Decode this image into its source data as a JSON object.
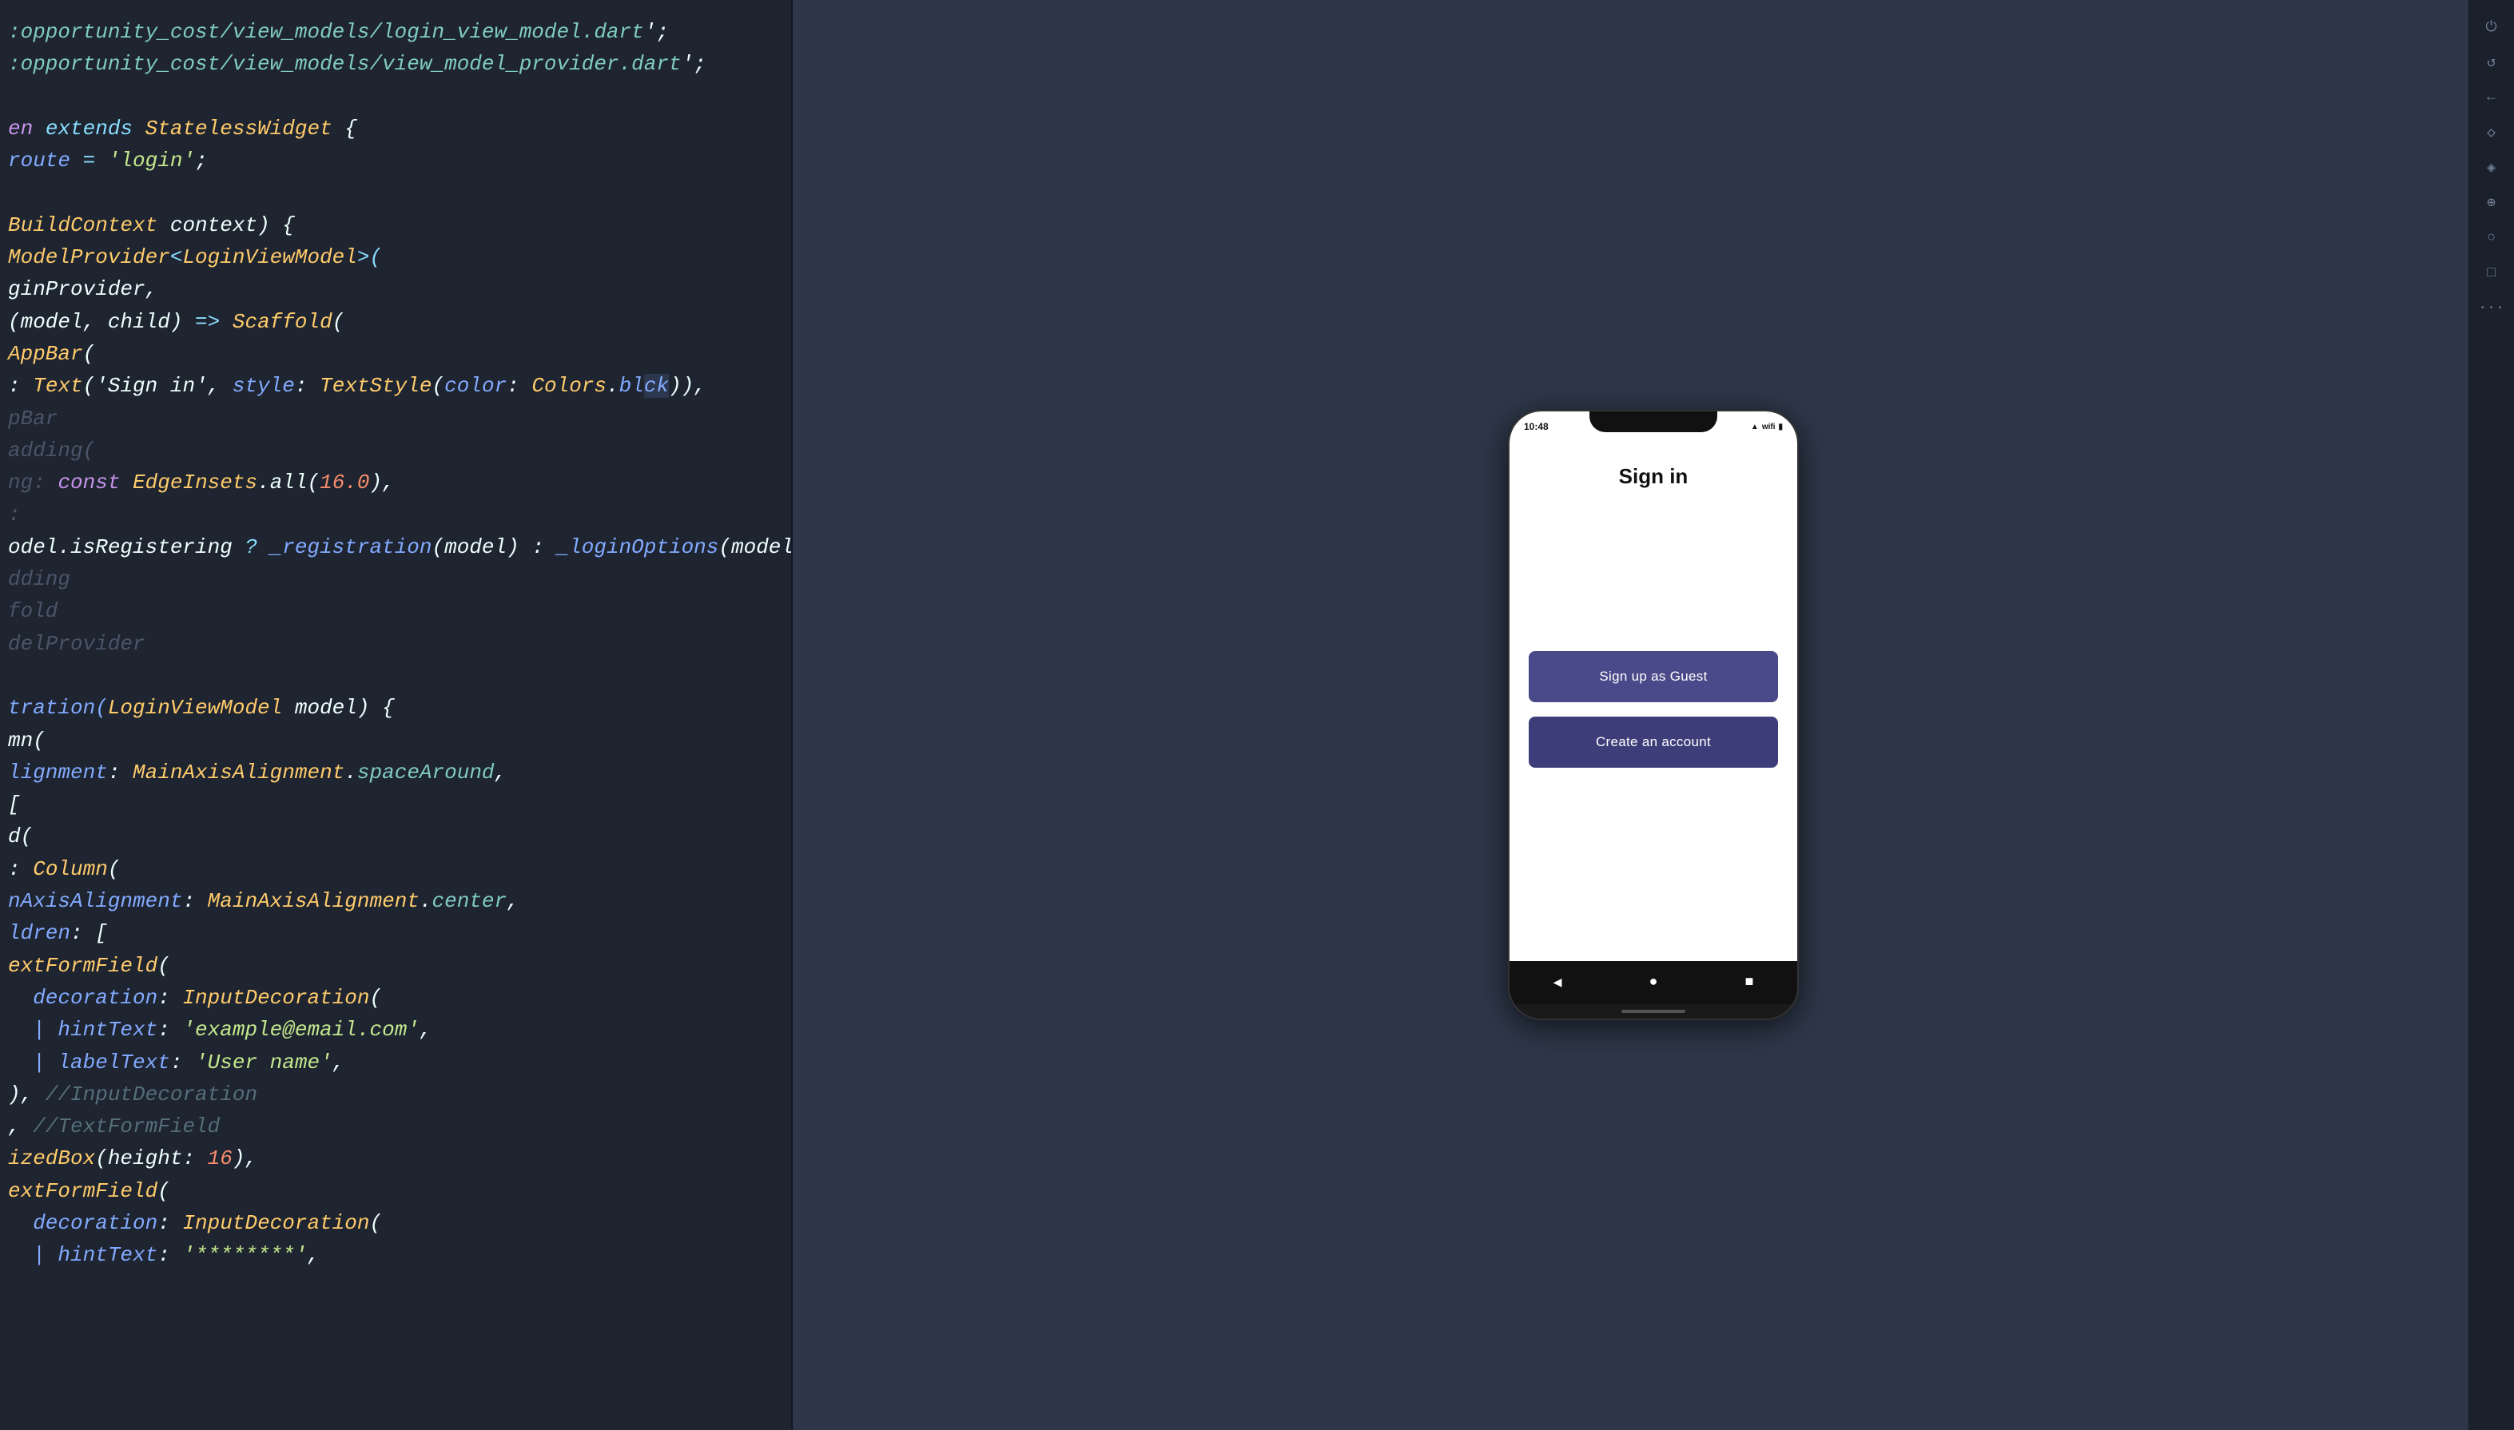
{
  "editor": {
    "lines": [
      {
        "id": 1,
        "segments": [
          {
            "text": ":opportunity_cost/view_models/login_view_model.dart",
            "class": "kw-teal"
          },
          {
            "text": "';",
            "class": "kw-white"
          }
        ]
      },
      {
        "id": 2,
        "segments": [
          {
            "text": ":opportunity_cost/view_models/view_model_provider.dart",
            "class": "kw-teal"
          },
          {
            "text": "';",
            "class": "kw-white"
          }
        ]
      },
      {
        "id": 3,
        "segments": []
      },
      {
        "id": 4,
        "segments": [
          {
            "text": "en ",
            "class": "kw-purple"
          },
          {
            "text": "extends ",
            "class": "kw-cyan"
          },
          {
            "text": "StatelessWidget ",
            "class": "kw-yellow"
          },
          {
            "text": "{",
            "class": "kw-white"
          }
        ]
      },
      {
        "id": 5,
        "segments": [
          {
            "text": "route ",
            "class": "kw-blue"
          },
          {
            "text": "= ",
            "class": "kw-cyan"
          },
          {
            "text": "'login'",
            "class": "kw-string"
          },
          {
            "text": ";",
            "class": "kw-white"
          }
        ]
      },
      {
        "id": 6,
        "segments": []
      },
      {
        "id": 7,
        "segments": [
          {
            "text": "BuildContext ",
            "class": "kw-yellow"
          },
          {
            "text": "context",
            "class": "kw-white"
          },
          {
            "text": ") {",
            "class": "kw-white"
          }
        ]
      },
      {
        "id": 8,
        "segments": [
          {
            "text": "ModelProvider",
            "class": "kw-yellow"
          },
          {
            "text": "<",
            "class": "kw-cyan"
          },
          {
            "text": "LoginViewModel",
            "class": "kw-yellow"
          },
          {
            "text": ">(",
            "class": "kw-cyan"
          }
        ]
      },
      {
        "id": 9,
        "segments": [
          {
            "text": "ginProvider,",
            "class": "kw-white"
          }
        ]
      },
      {
        "id": 10,
        "segments": [
          {
            "text": "(model, child) ",
            "class": "kw-white"
          },
          {
            "text": "=> ",
            "class": "kw-cyan"
          },
          {
            "text": "Scaffold",
            "class": "kw-yellow"
          },
          {
            "text": "(",
            "class": "kw-white"
          }
        ]
      },
      {
        "id": 11,
        "segments": [
          {
            "text": "AppBar",
            "class": "kw-yellow"
          },
          {
            "text": "(",
            "class": "kw-white"
          }
        ]
      },
      {
        "id": 12,
        "segments": [
          {
            "text": ": ",
            "class": "kw-white"
          },
          {
            "text": "Text",
            "class": "kw-yellow"
          },
          {
            "text": "('Sign in', ",
            "class": "kw-white"
          },
          {
            "text": "style",
            "class": "kw-blue"
          },
          {
            "text": ": ",
            "class": "kw-white"
          },
          {
            "text": "TextStyle",
            "class": "kw-yellow"
          },
          {
            "text": "(",
            "class": "kw-white"
          },
          {
            "text": "color",
            "class": "kw-blue"
          },
          {
            "text": ": ",
            "class": "kw-white"
          },
          {
            "text": "Colors",
            "class": "kw-yellow"
          },
          {
            "text": ".",
            "class": "kw-white"
          },
          {
            "text": "bl",
            "class": "kw-blue"
          },
          {
            "text": "ck",
            "class": "kw-blue highlight-bg"
          },
          {
            "text": ")),",
            "class": "kw-white"
          }
        ],
        "highlight": true
      },
      {
        "id": 13,
        "segments": [
          {
            "text": "pBar",
            "class": "kw-dim"
          }
        ]
      },
      {
        "id": 14,
        "segments": [
          {
            "text": "adding",
            "class": "kw-dim"
          },
          {
            "text": "(",
            "class": "kw-dim"
          }
        ]
      },
      {
        "id": 15,
        "segments": [
          {
            "text": "ng",
            "class": "kw-dim"
          },
          {
            "text": ": ",
            "class": "kw-dim"
          },
          {
            "text": "const ",
            "class": "kw-purple"
          },
          {
            "text": "EdgeInsets",
            "class": "kw-yellow"
          },
          {
            "text": ".all(",
            "class": "kw-white"
          },
          {
            "text": "16.0",
            "class": "kw-orange"
          },
          {
            "text": "),",
            "class": "kw-white"
          }
        ]
      },
      {
        "id": 16,
        "segments": [
          {
            "text": ":",
            "class": "kw-dim"
          }
        ]
      },
      {
        "id": 17,
        "segments": [
          {
            "text": "odel.isRegistering ",
            "class": "kw-white"
          },
          {
            "text": "? ",
            "class": "kw-cyan"
          },
          {
            "text": "_registration",
            "class": "kw-blue"
          },
          {
            "text": "(model) : ",
            "class": "kw-white"
          },
          {
            "text": "_loginOptions",
            "class": "kw-blue"
          },
          {
            "text": "(model),",
            "class": "kw-white"
          }
        ]
      },
      {
        "id": 18,
        "segments": [
          {
            "text": "dding",
            "class": "kw-dim"
          }
        ]
      },
      {
        "id": 19,
        "segments": [
          {
            "text": "fold",
            "class": "kw-dim"
          }
        ]
      },
      {
        "id": 20,
        "segments": [
          {
            "text": "delProvider",
            "class": "kw-dim"
          }
        ]
      },
      {
        "id": 21,
        "segments": []
      },
      {
        "id": 22,
        "segments": [
          {
            "text": "tration(",
            "class": "kw-blue"
          },
          {
            "text": "LoginViewModel ",
            "class": "kw-yellow"
          },
          {
            "text": "model) {",
            "class": "kw-white"
          }
        ]
      },
      {
        "id": 23,
        "segments": [
          {
            "text": "mn(",
            "class": "kw-white"
          }
        ]
      },
      {
        "id": 24,
        "segments": [
          {
            "text": "lignment",
            "class": "kw-blue"
          },
          {
            "text": ": ",
            "class": "kw-white"
          },
          {
            "text": "MainAxisAlignment",
            "class": "kw-yellow"
          },
          {
            "text": ".",
            "class": "kw-white"
          },
          {
            "text": "spaceAround",
            "class": "kw-teal"
          },
          {
            "text": ",",
            "class": "kw-white"
          }
        ]
      },
      {
        "id": 25,
        "segments": [
          {
            "text": "[",
            "class": "kw-white"
          }
        ]
      },
      {
        "id": 26,
        "segments": [
          {
            "text": "d(",
            "class": "kw-white"
          }
        ]
      },
      {
        "id": 27,
        "segments": [
          {
            "text": ": ",
            "class": "kw-white"
          },
          {
            "text": "Column",
            "class": "kw-yellow"
          },
          {
            "text": "(",
            "class": "kw-white"
          }
        ]
      },
      {
        "id": 28,
        "segments": [
          {
            "text": "nAxisAlignment",
            "class": "kw-blue"
          },
          {
            "text": ": ",
            "class": "kw-white"
          },
          {
            "text": "MainAxisAlignment",
            "class": "kw-yellow"
          },
          {
            "text": ".",
            "class": "kw-white"
          },
          {
            "text": "center",
            "class": "kw-teal"
          },
          {
            "text": ",",
            "class": "kw-white"
          }
        ]
      },
      {
        "id": 29,
        "segments": [
          {
            "text": "ldren",
            "class": "kw-blue"
          },
          {
            "text": ": [",
            "class": "kw-white"
          }
        ]
      },
      {
        "id": 30,
        "segments": [
          {
            "text": "extFormField",
            "class": "kw-yellow"
          },
          {
            "text": "(",
            "class": "kw-white"
          }
        ]
      },
      {
        "id": 31,
        "segments": [
          {
            "text": "  decoration",
            "class": "kw-blue"
          },
          {
            "text": ": ",
            "class": "kw-white"
          },
          {
            "text": "InputDecoration",
            "class": "kw-yellow"
          },
          {
            "text": "(",
            "class": "kw-white"
          }
        ]
      },
      {
        "id": 32,
        "segments": [
          {
            "text": "  | hintText",
            "class": "kw-blue"
          },
          {
            "text": ": ",
            "class": "kw-white"
          },
          {
            "text": "'example@email.com'",
            "class": "kw-string"
          },
          {
            "text": ",",
            "class": "kw-white"
          }
        ]
      },
      {
        "id": 33,
        "segments": [
          {
            "text": "  | labelText",
            "class": "kw-blue"
          },
          {
            "text": ": ",
            "class": "kw-white"
          },
          {
            "text": "'User name'",
            "class": "kw-string"
          },
          {
            "text": ",",
            "class": "kw-white"
          }
        ]
      },
      {
        "id": 34,
        "segments": [
          {
            "text": "), ",
            "class": "kw-white"
          },
          {
            "text": "//InputDecoration",
            "class": "kw-comment"
          }
        ]
      },
      {
        "id": 35,
        "segments": [
          {
            "text": ", ",
            "class": "kw-white"
          },
          {
            "text": "//TextFormField",
            "class": "kw-comment"
          }
        ]
      },
      {
        "id": 36,
        "segments": [
          {
            "text": "izedBox",
            "class": "kw-yellow"
          },
          {
            "text": "(height: ",
            "class": "kw-white"
          },
          {
            "text": "16",
            "class": "kw-orange"
          },
          {
            "text": "),",
            "class": "kw-white"
          }
        ]
      },
      {
        "id": 37,
        "segments": [
          {
            "text": "extFormField",
            "class": "kw-yellow"
          },
          {
            "text": "(",
            "class": "kw-white"
          }
        ]
      },
      {
        "id": 38,
        "segments": [
          {
            "text": "  decoration",
            "class": "kw-blue"
          },
          {
            "text": ": ",
            "class": "kw-white"
          },
          {
            "text": "InputDecoration",
            "class": "kw-yellow"
          },
          {
            "text": "(",
            "class": "kw-white"
          }
        ]
      },
      {
        "id": 39,
        "segments": [
          {
            "text": "  | hintText",
            "class": "kw-blue"
          },
          {
            "text": ": ",
            "class": "kw-white"
          },
          {
            "text": "'********'",
            "class": "kw-string"
          },
          {
            "text": ",",
            "class": "kw-white"
          }
        ]
      }
    ]
  },
  "phone": {
    "status_time": "10:48",
    "screen_title": "Sign in",
    "btn_guest": "Sign up as Guest",
    "btn_create": "Create an account",
    "nav_back": "◀",
    "nav_home": "●",
    "nav_square": "■"
  },
  "tools": {
    "icons": [
      "⏻",
      "↺",
      "←",
      "◇",
      "◈",
      "🔍",
      "⊕",
      "◯",
      "□",
      "···"
    ]
  }
}
